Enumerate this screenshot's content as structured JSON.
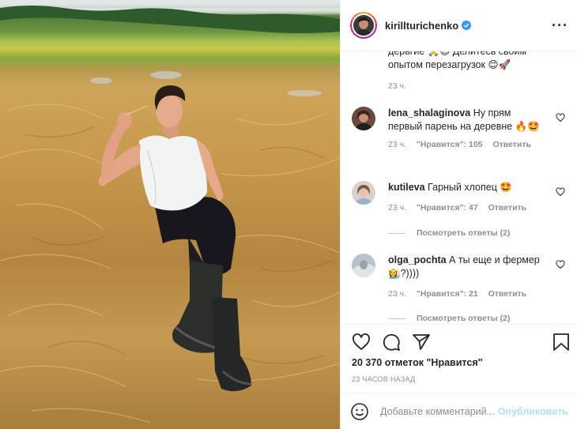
{
  "post": {
    "username": "kirillturichenko",
    "verified": true,
    "caption_tail_line1": "дерьгие 🙏😊 Делитесь своим",
    "caption_tail_line2": "опытом перезагрузок 😊🚀",
    "caption_time": "23 ч."
  },
  "comments": [
    {
      "username": "lena_shalaginova",
      "text": "Ну прям первый парень на деревне 🔥🤩",
      "time": "23 ч.",
      "likes": "\"Нравится\": 105",
      "reply": "Ответить"
    },
    {
      "username": "kutileva",
      "text": "Гарный хлопец 🤩",
      "time": "23 ч.",
      "likes": "\"Нравится\": 47",
      "reply": "Ответить",
      "view_replies": "Посмотреть ответы (2)"
    },
    {
      "username": "olga_pochta",
      "text": "А ты еще и фермер 👩‍🌾?))))",
      "time": "23 ч.",
      "likes": "\"Нравится\": 21",
      "reply": "Ответить",
      "view_replies": "Посмотреть ответы (2)"
    }
  ],
  "actions": {
    "likes_count": "20 370 отметок \"Нравится\"",
    "posted_ago": "23 ЧАСОВ НАЗАД"
  },
  "add_comment": {
    "placeholder": "Добавьте комментарий...",
    "publish": "Опубликовать"
  },
  "icons": {
    "more": "more-options-icon",
    "heart": "heart-icon",
    "comment": "comment-icon",
    "share": "share-icon",
    "bookmark": "bookmark-icon",
    "emoji": "emoji-icon",
    "verified": "verified-badge-icon"
  },
  "colors": {
    "text": "#262626",
    "muted": "#8e8e8e",
    "border": "#efefef",
    "verified": "#3897f0",
    "publish_disabled": "#b2dffc"
  }
}
